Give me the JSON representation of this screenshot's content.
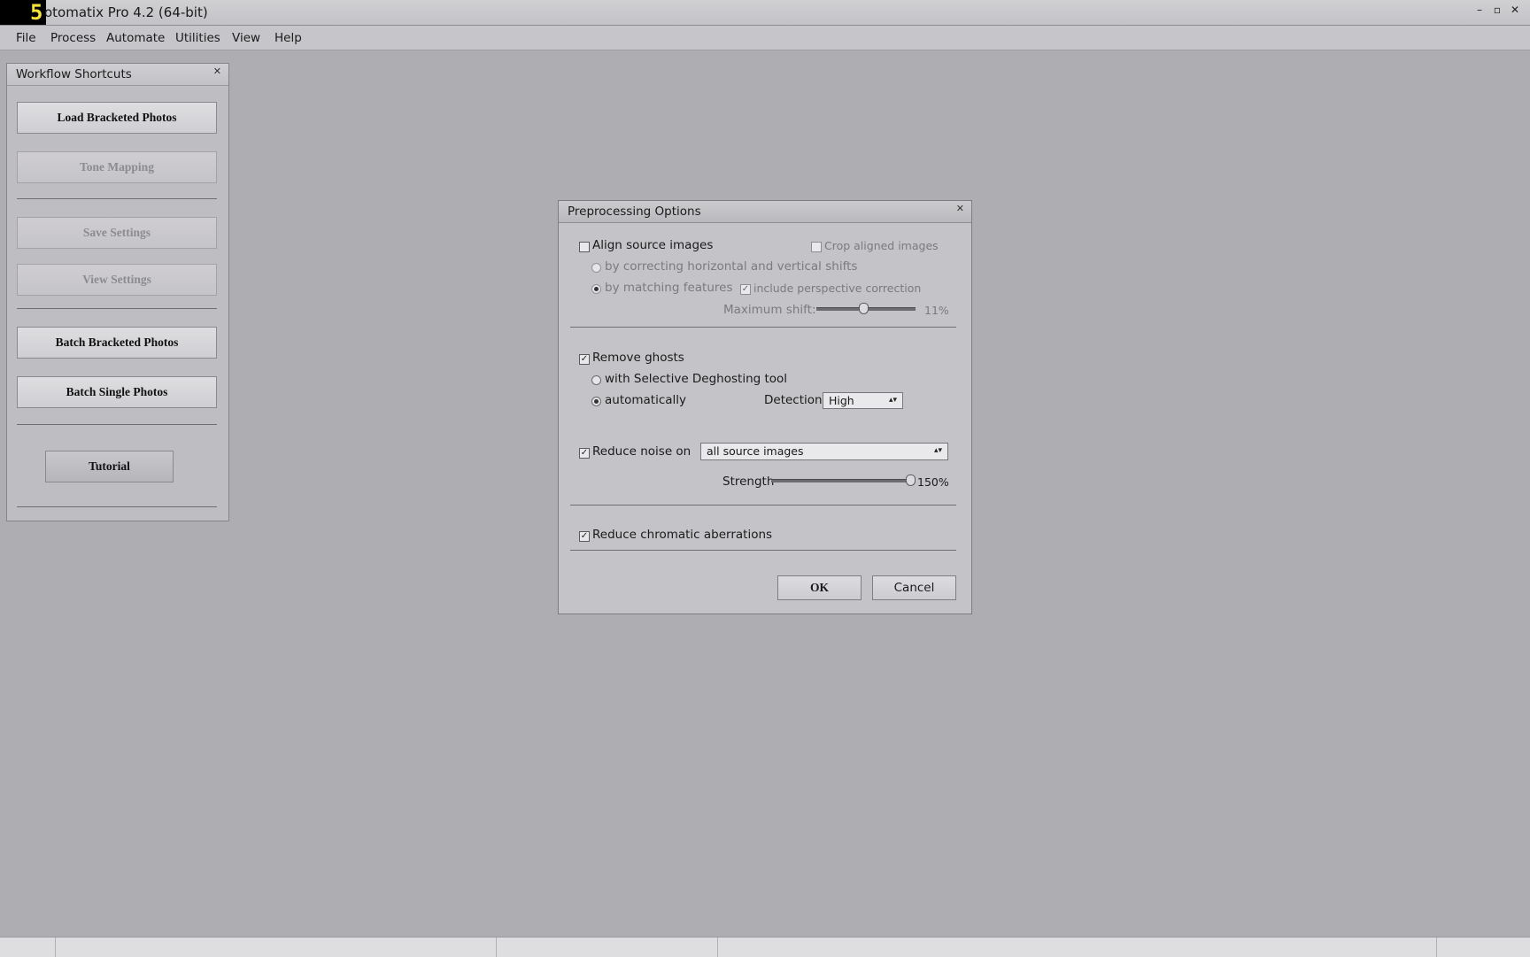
{
  "app": {
    "icon_glyph": "5",
    "title": "otomatix Pro 4.2 (64-bit)",
    "controls": [
      "–",
      "▫",
      "✕"
    ]
  },
  "menu": [
    "File",
    "Process",
    "Automate",
    "Utilities",
    "View",
    "Help"
  ],
  "workflow": {
    "title": "Workflow Shortcuts",
    "close": "✕",
    "buttons": {
      "load": "Load Bracketed Photos",
      "tone": "Tone Mapping",
      "save": "Save Settings",
      "view": "View Settings",
      "batch_bracketed": "Batch Bracketed Photos",
      "batch_single": "Batch Single Photos",
      "tutorial": "Tutorial"
    }
  },
  "dialog": {
    "title": "Preprocessing Options",
    "close": "✕",
    "align": {
      "label": "Align source images",
      "checked": false,
      "crop_label": "Crop aligned images",
      "option_shifts": "by correcting horizontal and vertical shifts",
      "option_features": "by matching features",
      "perspective_label": "include perspective correction",
      "perspective_checked": true,
      "max_shift_label": "Maximum shift:",
      "max_shift_value": "11%"
    },
    "ghosts": {
      "label": "Remove ghosts",
      "checked": true,
      "option_tool": "with Selective Deghosting tool",
      "option_auto": "automatically",
      "detection_label": "Detection:",
      "detection_value": "High"
    },
    "noise": {
      "label": "Reduce noise on",
      "checked": true,
      "target_value": "all source images",
      "strength_label": "Strength",
      "strength_value": "150%"
    },
    "chromatic": {
      "label": "Reduce chromatic aberrations",
      "checked": true
    },
    "ok": "OK",
    "cancel": "Cancel"
  },
  "check_mark": "✓"
}
